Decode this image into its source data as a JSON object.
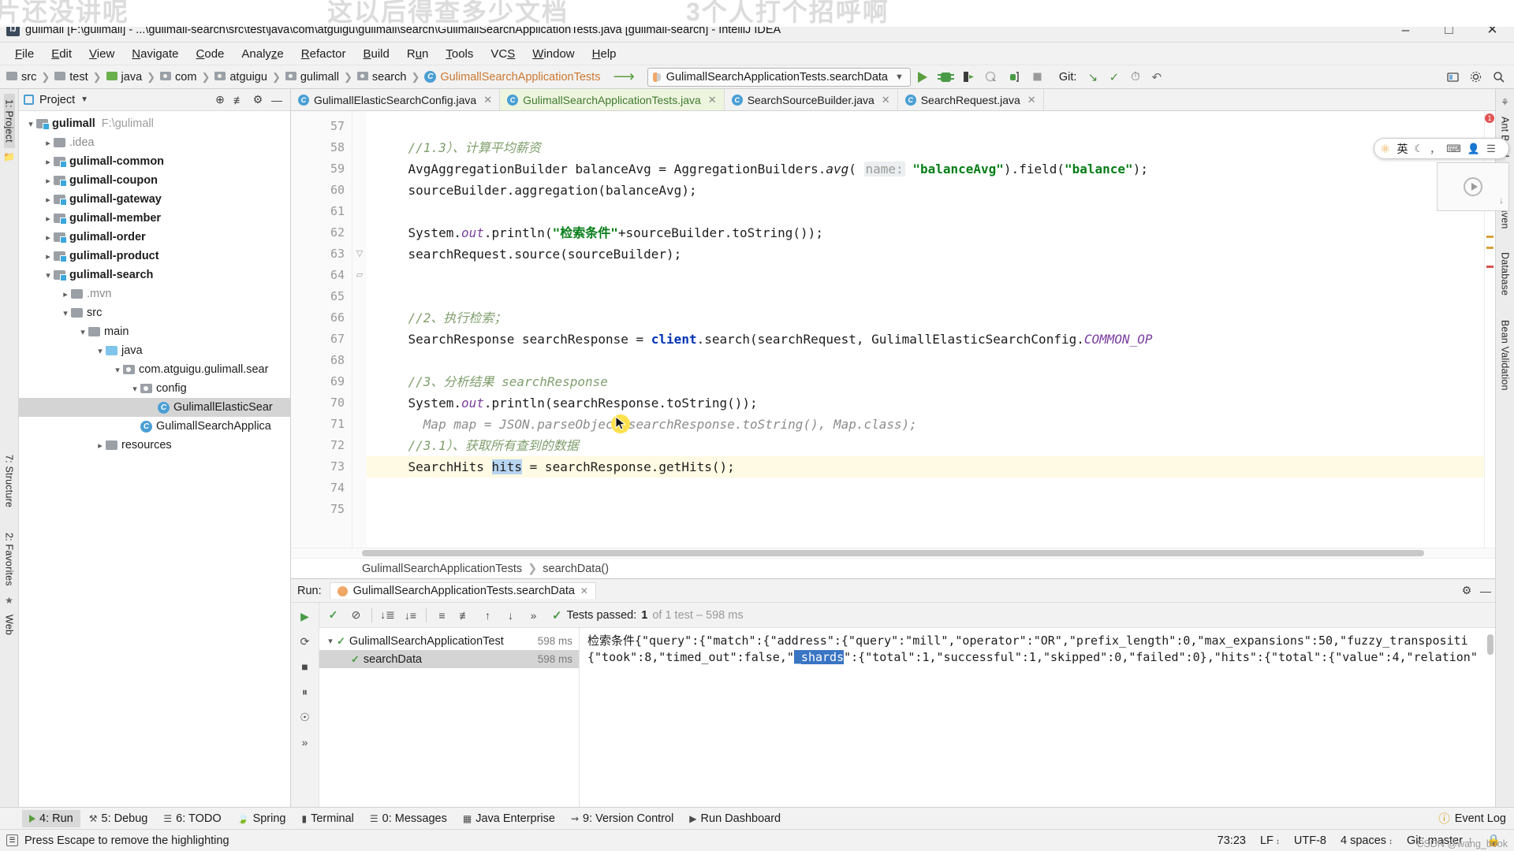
{
  "watermark": {
    "left": "片还没讲呢",
    "center": "这以后得查多少文档",
    "right": "3个人打个招呼啊"
  },
  "titlebar": {
    "text": "gulimall [F:\\gulimall] - ...\\gulimall-search\\src\\test\\java\\com\\atguigu\\gulimall\\search\\GulimallSearchApplicationTests.java [gulimall-search] - IntelliJ IDEA",
    "app_icon": "intellij-idea-icon",
    "minimize": "–",
    "maximize": "□",
    "close": "✕"
  },
  "menubar": {
    "items": [
      "File",
      "Edit",
      "View",
      "Navigate",
      "Code",
      "Analyze",
      "Refactor",
      "Build",
      "Run",
      "Tools",
      "VCS",
      "Window",
      "Help"
    ]
  },
  "navbar": {
    "breadcrumbs": [
      {
        "label": "src",
        "icon": "folder-grey"
      },
      {
        "label": "test",
        "icon": "folder-grey"
      },
      {
        "label": "java",
        "icon": "folder-green"
      },
      {
        "label": "com",
        "icon": "package-icon"
      },
      {
        "label": "atguigu",
        "icon": "package-icon"
      },
      {
        "label": "gulimall",
        "icon": "package-icon"
      },
      {
        "label": "search",
        "icon": "package-icon"
      },
      {
        "label": "GulimallSearchApplicationTests",
        "icon": "class-icon"
      }
    ],
    "run_config": "GulimallSearchApplicationTests.searchData",
    "git_label": "Git:",
    "buttons": [
      "run-icon",
      "debug-icon",
      "run-with-coverage-icon",
      "profile-icon",
      "attach-debugger-icon",
      "stop-icon"
    ],
    "git_buttons": [
      "update-project-icon",
      "commit-icon",
      "history-icon",
      "rollback-icon"
    ],
    "right_buttons": [
      "select-in-icon",
      "settings-icon",
      "search-everywhere-icon"
    ]
  },
  "project_panel": {
    "title": "Project",
    "header_buttons": [
      "locate-icon",
      "collapse-all-icon",
      "gear-icon"
    ],
    "tree": [
      {
        "depth": 0,
        "label": "gulimall",
        "path": "F:\\gulimall",
        "toggle": "v",
        "icon": "module-folder",
        "bold": true
      },
      {
        "depth": 1,
        "label": ".idea",
        "toggle": ">",
        "icon": "folder-grey",
        "dim": true
      },
      {
        "depth": 1,
        "label": "gulimall-common",
        "toggle": ">",
        "icon": "module-folder",
        "bold": true
      },
      {
        "depth": 1,
        "label": "gulimall-coupon",
        "toggle": ">",
        "icon": "module-folder",
        "bold": true
      },
      {
        "depth": 1,
        "label": "gulimall-gateway",
        "toggle": ">",
        "icon": "module-folder",
        "bold": true
      },
      {
        "depth": 1,
        "label": "gulimall-member",
        "toggle": ">",
        "icon": "module-folder",
        "bold": true
      },
      {
        "depth": 1,
        "label": "gulimall-order",
        "toggle": ">",
        "icon": "module-folder",
        "bold": true
      },
      {
        "depth": 1,
        "label": "gulimall-product",
        "toggle": ">",
        "icon": "module-folder",
        "bold": true
      },
      {
        "depth": 1,
        "label": "gulimall-search",
        "toggle": "v",
        "icon": "module-folder",
        "bold": true
      },
      {
        "depth": 2,
        "label": ".mvn",
        "toggle": ">",
        "icon": "folder-grey",
        "dim": true
      },
      {
        "depth": 2,
        "label": "src",
        "toggle": "v",
        "icon": "folder-grey"
      },
      {
        "depth": 3,
        "label": "main",
        "toggle": "v",
        "icon": "folder-grey"
      },
      {
        "depth": 4,
        "label": "java",
        "toggle": "v",
        "icon": "folder-blue"
      },
      {
        "depth": 5,
        "label": "com.atguigu.gulimall.sear",
        "toggle": "v",
        "icon": "package-icon"
      },
      {
        "depth": 6,
        "label": "config",
        "toggle": "v",
        "icon": "package-icon"
      },
      {
        "depth": 7,
        "label": "GulimallElasticSear",
        "icon": "class-icon",
        "selected": true
      },
      {
        "depth": 6,
        "label": "GulimallSearchApplica",
        "icon": "class-icon"
      },
      {
        "depth": 4,
        "label": "resources",
        "toggle": ">",
        "icon": "folder-grey"
      }
    ]
  },
  "left_rail": {
    "items": [
      "1: Project",
      "7: Structure",
      "2: Favorites",
      "Web"
    ]
  },
  "right_rail": {
    "items": [
      "Ant Build",
      "Maven",
      "Database",
      "Bean Validation"
    ]
  },
  "editor": {
    "tabs": [
      {
        "label": "GulimallElasticSearchConfig.java",
        "icon": "class-icon",
        "active": false
      },
      {
        "label": "GulimallSearchApplicationTests.java",
        "icon": "class-icon",
        "active": true
      },
      {
        "label": "SearchSourceBuilder.java",
        "icon": "class-icon",
        "active": false
      },
      {
        "label": "SearchRequest.java",
        "icon": "class-icon",
        "active": false
      }
    ],
    "first_line": 57,
    "lines": [
      {
        "n": 57,
        "text": ""
      },
      {
        "n": 58,
        "text": "    //1.3）、计算平均薪资",
        "type": "comment"
      },
      {
        "n": 59,
        "text": "    AvgAggregationBuilder balanceAvg = AggregationBuilders.avg( name: \"balanceAvg\").field(\"balance\");"
      },
      {
        "n": 60,
        "text": "    sourceBuilder.aggregation(balanceAvg);"
      },
      {
        "n": 61,
        "text": ""
      },
      {
        "n": 62,
        "text": "    System.out.println(\"检索条件\"+sourceBuilder.toString());"
      },
      {
        "n": 63,
        "text": "    searchRequest.source(sourceBuilder);"
      },
      {
        "n": 64,
        "text": ""
      },
      {
        "n": 65,
        "text": ""
      },
      {
        "n": 66,
        "text": "    //2、执行检索；",
        "type": "comment"
      },
      {
        "n": 67,
        "text": "    SearchResponse searchResponse = client.search(searchRequest, GulimallElasticSearchConfig.COMMON_OP"
      },
      {
        "n": 68,
        "text": ""
      },
      {
        "n": 69,
        "text": "    //3、分析结果 searchResponse",
        "type": "comment"
      },
      {
        "n": 70,
        "text": "    System.out.println(searchResponse.toString());"
      },
      {
        "n": 71,
        "text": "//      Map map = JSON.parseObject(searchResponse.toString(), Map.class);",
        "type": "commented-code"
      },
      {
        "n": 72,
        "text": "    //3.1）、获取所有查到的数据",
        "type": "comment"
      },
      {
        "n": 73,
        "text": "    SearchHits hits = searchResponse.getHits();",
        "highlight": true
      },
      {
        "n": 74,
        "text": ""
      },
      {
        "n": 75,
        "text": ""
      }
    ],
    "breadcrumb": [
      "GulimallSearchApplicationTests",
      "searchData()"
    ],
    "error_count": "1"
  },
  "run_panel": {
    "label": "Run:",
    "tab_title": "GulimallSearchApplicationTests.searchData",
    "status": {
      "prefix": "Tests passed:",
      "count": "1",
      "suffix": "of 1 test – 598 ms"
    },
    "toolbar_buttons": [
      "rerun-icon",
      "rerun-failed-icon",
      "sort-alphabetically-icon",
      "sort-by-duration-icon",
      "expand-all-icon",
      "collapse-all-icon",
      "prev-test-icon",
      "next-test-icon",
      "more-icon"
    ],
    "left_rail_buttons": [
      "run-icon",
      "stop-icon",
      "rerun-icon",
      "pause-icon",
      "camera-icon",
      "more-icon"
    ],
    "tests": [
      {
        "depth": 0,
        "toggle": "v",
        "name": "GulimallSearchApplicationTest",
        "time": "598 ms",
        "status": "passed"
      },
      {
        "depth": 1,
        "toggle": "",
        "name": "searchData",
        "time": "598 ms",
        "status": "passed",
        "selected": true
      }
    ],
    "console_line1": "检索条件{\"query\":{\"match\":{\"address\":{\"query\":\"mill\",\"operator\":\"OR\",\"prefix_length\":0,\"max_expansions\":50,\"fuzzy_transpositi",
    "console_line2_pre": "{\"took\":8,\"timed_out\":false,\"",
    "console_line2_sel": "_shards",
    "console_line2_post": "\":{\"total\":1,\"successful\":1,\"skipped\":0,\"failed\":0},\"hits\":{\"total\":{\"value\":4,\"relation\""
  },
  "ime": {
    "logo": "ime-logo-icon",
    "lang": "英",
    "moon": "☾",
    "punct": "，",
    "keyboard": "keyboard-icon",
    "user": "user-icon",
    "menu": "menu-icon"
  },
  "toolwindow_bar": {
    "items": [
      {
        "label": "4: Run",
        "icon": "run-icon",
        "selected": true
      },
      {
        "label": "5: Debug",
        "icon": "debug-icon"
      },
      {
        "label": "6: TODO",
        "icon": "todo-icon"
      },
      {
        "label": "Spring",
        "icon": "spring-icon"
      },
      {
        "label": "Terminal",
        "icon": "terminal-icon"
      },
      {
        "label": "0: Messages",
        "icon": "messages-icon"
      },
      {
        "label": "Java Enterprise",
        "icon": "java-enterprise-icon"
      },
      {
        "label": "9: Version Control",
        "icon": "version-control-icon"
      },
      {
        "label": "Run Dashboard",
        "icon": "run-dashboard-icon"
      }
    ],
    "event_log": "Event Log"
  },
  "statusbar": {
    "message": "Press Escape to remove the highlighting",
    "caret": "73:23",
    "line_sep": "LF",
    "encoding": "UTF-8",
    "indent": "4 spaces",
    "branch": "Git: master"
  },
  "csdn": "CSDN @wang_book"
}
